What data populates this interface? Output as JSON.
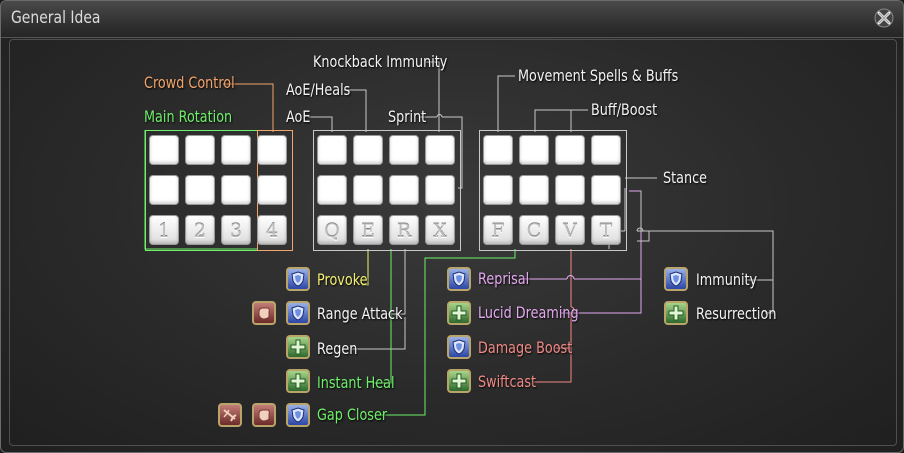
{
  "window": {
    "title": "General Idea"
  },
  "labels": {
    "crowd_control": "Crowd Control",
    "main_rotation": "Main Rotation",
    "aoe_heals": "AoE/Heals",
    "aoe": "AoE",
    "knockback_immunity": "Knockback Immunity",
    "sprint": "Sprint",
    "movement": "Movement Spells & Buffs",
    "buff_boost": "Buff/Boost",
    "stance": "Stance"
  },
  "keys": {
    "group1": [
      "1",
      "2",
      "3",
      "4"
    ],
    "group2": [
      "Q",
      "E",
      "R",
      "X"
    ],
    "group3": [
      "F",
      "C",
      "V",
      "T"
    ]
  },
  "legend": {
    "provoke": "Provoke",
    "range_attack": "Range Attack",
    "regen": "Regen",
    "instant_heal": "Instant Heal",
    "gap_closer": "Gap Closer",
    "reprisal": "Reprisal",
    "lucid_dreaming": "Lucid Dreaming",
    "damage_boost": "Damage Boost",
    "swiftcast": "Swiftcast",
    "immunity": "Immunity",
    "resurrection": "Resurrection"
  },
  "colors": {
    "crowd_control": "#f3a46a",
    "main_rotation": "#6ff06a",
    "tank_role": "#2c47a6",
    "healer_role": "#2e6a2e",
    "dps_role": "#6b2a28"
  },
  "icons": {
    "tank": "shield-icon",
    "healer": "cross-icon",
    "dps": "fist-icon"
  }
}
